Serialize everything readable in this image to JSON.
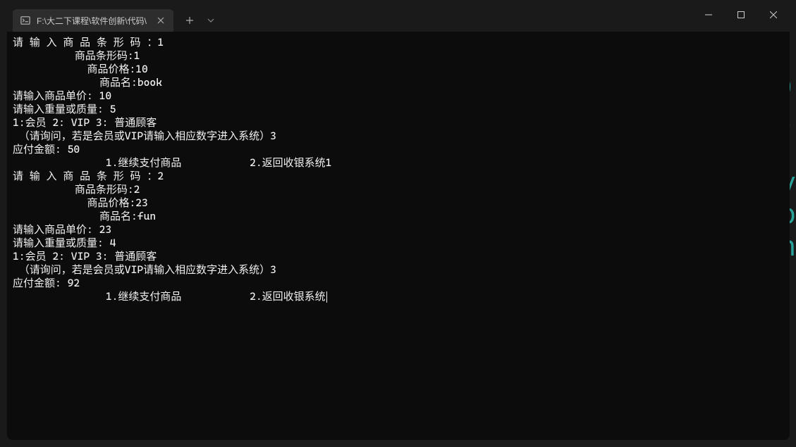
{
  "titlebar": {
    "tab_title": "F:\\大二下课程\\软件创新\\代码\\"
  },
  "terminal": {
    "lines": [
      "请 输 入 商 品 条 形 码 ：1",
      "          商品条形码:1",
      "            商品价格:10",
      "              商品名:book",
      "请输入商品单价: 10",
      "请输入重量或质量: 5",
      "1:会员 2: VIP 3: 普通顾客",
      " （请询问，若是会员或VIP请输入相应数字进入系统）3",
      "应付金额: 50",
      "               1.继续支付商品           2.返回收银系统1",
      "请 输 入 商 品 条 形 码 ：2",
      "          商品条形码:2",
      "            商品价格:23",
      "              商品名:fun",
      "请输入商品单价: 23",
      "请输入重量或质量: 4",
      "1:会员 2: VIP 3: 普通顾客",
      " （请询问，若是会员或VIP请输入相应数字进入系统）3",
      "应付金额: 92",
      "               1.继续支付商品           2.返回收银系统"
    ]
  }
}
